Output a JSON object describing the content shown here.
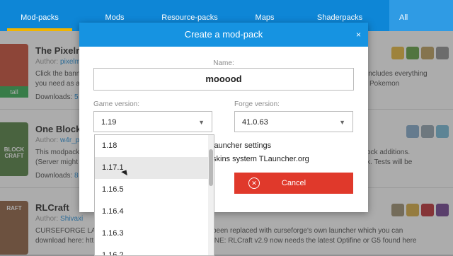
{
  "nav": {
    "tabs": [
      {
        "label": "Mod-packs"
      },
      {
        "label": "Mods"
      },
      {
        "label": "Resource-packs"
      },
      {
        "label": "Maps"
      },
      {
        "label": "Shaderpacks"
      },
      {
        "label": "All"
      }
    ]
  },
  "list": [
    {
      "title": "The Pixelm",
      "author_label": "Author:",
      "author": "pixelm",
      "desc_left": "Click the bann",
      "desc_left2": "you need as a",
      "desc_right": "includes everything",
      "desc_right2": "Pokemon",
      "downloads_label": "Downloads:",
      "downloads": "5",
      "install_label": "tall"
    },
    {
      "title": "One Block",
      "author_label": "Author:",
      "author": "w4r_p",
      "desc_left": "This modpack",
      "desc_left2": "(Server might",
      "desc_right": "ock additions.",
      "desc_right2": "k. Tests will be",
      "downloads_label": "Downloads:",
      "downloads": "8",
      "thumb_text": "BLOCK CRAFT"
    },
    {
      "title": "RLCraft",
      "author_label": "Author:",
      "author": "Shivaxi",
      "desc_left": "CURSEFORGE LAU",
      "desc_left2": "download here: htt",
      "desc_right": "been replaced with curseforge's own launcher which you can",
      "desc_right2": "INE: RLCraft v2.9 now needs the latest Optifine or G5 found here",
      "thumb_text": "RAFT"
    }
  ],
  "modal": {
    "title": "Create a mod-pack",
    "close": "×",
    "name_label": "Name:",
    "name_value": "mooood",
    "game_version_label": "Game version:",
    "game_version_value": "1.19",
    "forge_version_label": "Forge version:",
    "forge_version_value": "41.0.63",
    "checkbox1_label": "launcher settings",
    "checkbox2_label": "skins system TLauncher.org",
    "cancel_label": "Cancel",
    "cancel_icon": "x-circle-icon"
  },
  "dropdown": {
    "options": [
      "1.18",
      "1.17.1",
      "1.16.5",
      "1.16.4",
      "1.16.3",
      "1.16.2"
    ],
    "hovered": "1.17.1"
  },
  "colors": {
    "nav_bg": "#0e86d6",
    "modal_header": "#1693e1",
    "cancel_bg": "#e0392b",
    "active_underline": "#f0b400"
  }
}
